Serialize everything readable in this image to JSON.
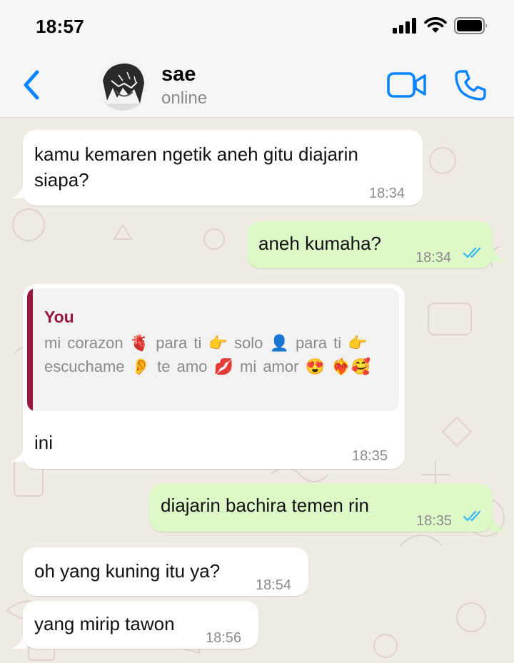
{
  "status_bar": {
    "time": "18:57"
  },
  "header": {
    "name": "sae",
    "status": "online"
  },
  "messages": [
    {
      "text": "kamu kemaren ngetik aneh gitu diajarin siapa?",
      "time": "18:34"
    },
    {
      "text": "aneh kumaha?",
      "time": "18:34"
    },
    {
      "reply_author": "You",
      "reply_text": "mi corazon 🫀 para ti 👉 solo 👤 para ti 👉 escuchame 👂 te amo 💋 mi amor 😍 ❤️‍🔥🥰",
      "text": "ini",
      "time": "18:35"
    },
    {
      "text": "diajarin bachira temen rin",
      "time": "18:35"
    },
    {
      "text": "oh yang kuning itu ya?",
      "time": "18:54"
    },
    {
      "text": "yang mirip tawon",
      "time": "18:56"
    }
  ],
  "colors": {
    "accent": "#0a84ff",
    "outgoing_bubble": "#dcf8c6",
    "incoming_bubble": "#ffffff",
    "chat_background": "#efeae2",
    "reply_accent": "#97173f",
    "read_ticks": "#34b7f1"
  }
}
